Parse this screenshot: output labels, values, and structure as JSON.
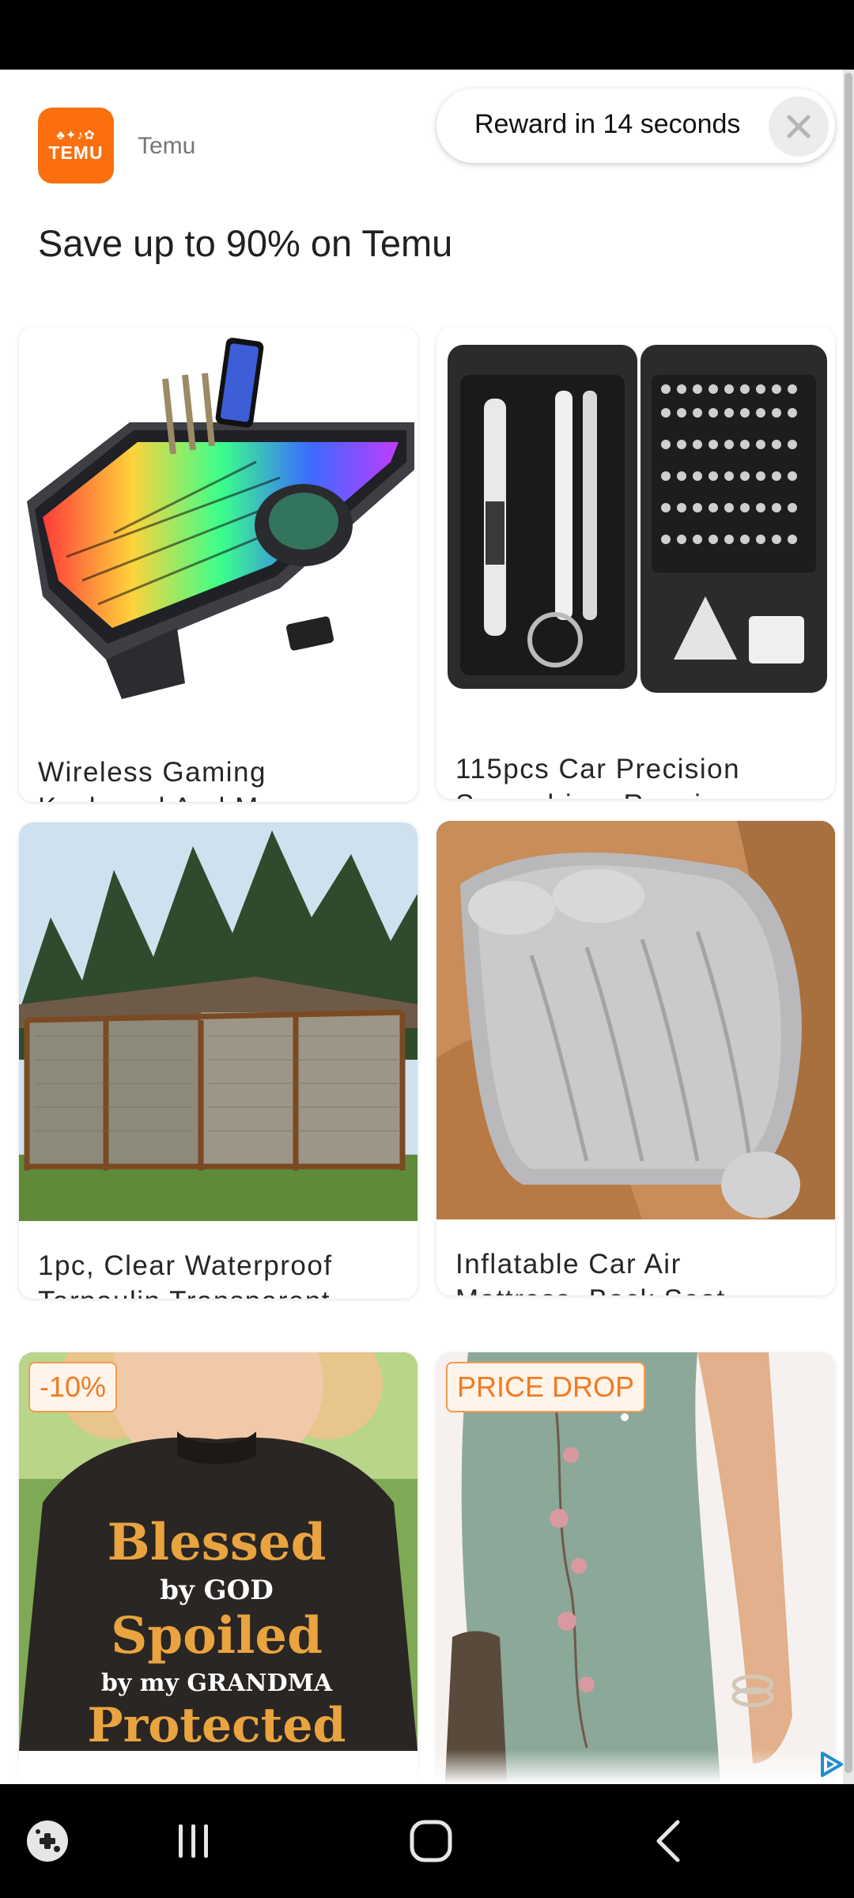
{
  "ad": {
    "brand": {
      "logo_glyphs": "♣✦♪✿",
      "logo_text": "TEMU",
      "name": "Temu"
    },
    "headline": "Save up to 90% on Temu",
    "reward": {
      "text": "Reward in 14 seconds",
      "close_icon": "close-icon"
    },
    "products": [
      {
        "title_line1": "Wireless Gaming",
        "title_line2": "Keyboard And Mouse,...",
        "badge": ""
      },
      {
        "title_line1": "115pcs Car Precision",
        "title_line2": "Screwdriver Repair...",
        "badge": ""
      },
      {
        "title_line1": "1pc, Clear Waterproof",
        "title_line2": "Tarpaulin Transparent...",
        "badge": ""
      },
      {
        "title_line1": "Inflatable Car Air",
        "title_line2": "Mattress, Back Seat...",
        "badge": ""
      },
      {
        "title_line1": "",
        "title_line2": "",
        "badge": "-10%",
        "shirt_text": [
          "Blessed",
          "by GOD",
          "Spoiled",
          "by my GRANDMA",
          "Protected"
        ]
      },
      {
        "title_line1": "",
        "title_line2": "",
        "badge": "PRICE DROP"
      }
    ],
    "adchoices_icon": "adchoices-icon"
  },
  "colors": {
    "brand_orange": "#fb6f0f",
    "badge_orange": "#f27a21"
  },
  "nav": {
    "icons": [
      "game-launcher-icon",
      "recents-icon",
      "home-icon",
      "back-icon"
    ]
  }
}
